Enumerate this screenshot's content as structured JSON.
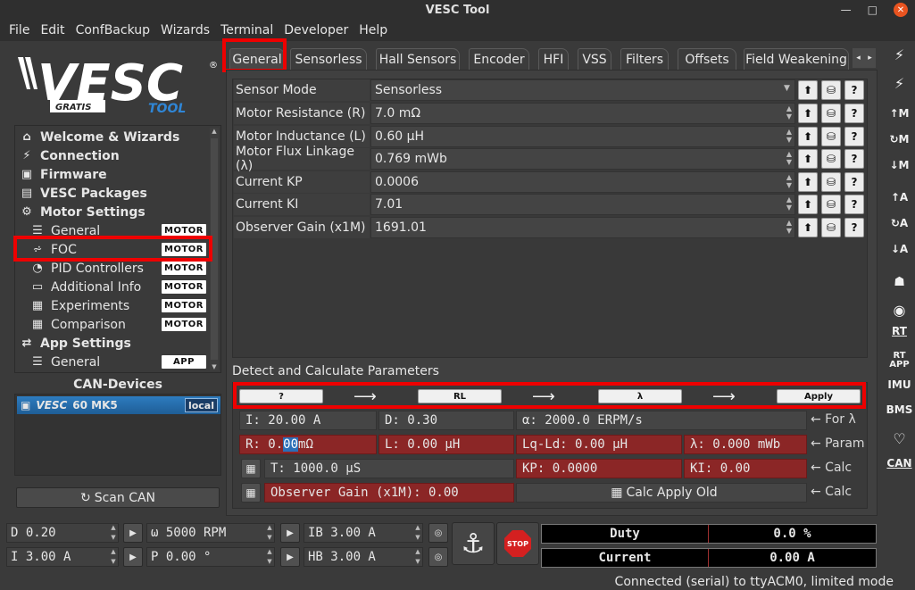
{
  "window": {
    "title": "VESC Tool"
  },
  "menu": [
    "File",
    "Edit",
    "ConfBackup",
    "Wizards",
    "Terminal",
    "Developer",
    "Help"
  ],
  "logo": {
    "brand": "VESC",
    "sub_left": "GRATIS",
    "sub_right": "TOOL",
    "reg": "®"
  },
  "nav": {
    "items": [
      {
        "label": "Welcome & Wizards",
        "icon": "home-icon"
      },
      {
        "label": "Connection",
        "icon": "plug-icon"
      },
      {
        "label": "Firmware",
        "icon": "chip-icon"
      },
      {
        "label": "VESC Packages",
        "icon": "package-icon"
      },
      {
        "label": "Motor Settings",
        "icon": "motor-icon"
      },
      {
        "label": "General",
        "icon": "sliders-icon",
        "badge": "MOTOR"
      },
      {
        "label": "FOC",
        "icon": "foc-icon",
        "badge": "MOTOR"
      },
      {
        "label": "PID Controllers",
        "icon": "gauge-icon",
        "badge": "MOTOR"
      },
      {
        "label": "Additional Info",
        "icon": "info-icon",
        "badge": "MOTOR"
      },
      {
        "label": "Experiments",
        "icon": "calculator-icon",
        "badge": "MOTOR"
      },
      {
        "label": "Comparison",
        "icon": "calculator-icon",
        "badge": "MOTOR"
      },
      {
        "label": "App Settings",
        "icon": "app-icon"
      },
      {
        "label": "General",
        "icon": "sliders-icon",
        "badge": "APP"
      }
    ]
  },
  "can": {
    "title": "CAN-Devices",
    "device": "60 MK5",
    "device_brand": "VESC",
    "local": "local",
    "scan_label": "Scan CAN"
  },
  "tabs": [
    "General",
    "Sensorless",
    "Hall Sensors",
    "Encoder",
    "HFI",
    "VSS",
    "Filters",
    "Offsets",
    "Field Weakening"
  ],
  "params": [
    {
      "label": "Sensor Mode",
      "value": "Sensorless"
    },
    {
      "label": "Motor Resistance (R)",
      "value": "7.0 mΩ"
    },
    {
      "label": "Motor Inductance (L)",
      "value": "0.60 µH"
    },
    {
      "label": "Motor Flux Linkage (λ)",
      "value": "0.769 mWb"
    },
    {
      "label": "Current KP",
      "value": "0.0006"
    },
    {
      "label": "Current KI",
      "value": "7.01"
    },
    {
      "label": "Observer Gain (x1M)",
      "value": "1691.01"
    }
  ],
  "detect": {
    "title": "Detect and Calculate Parameters",
    "btn_rl": "RL",
    "btn_lambda": "λ",
    "btn_apply": "Apply",
    "current": "I: 20.00 A",
    "duty": "D: 0.30",
    "erpm": "α: 2000.0 ERPM/s",
    "for_lambda": "← For λ",
    "r": "R: 0.00 mΩ",
    "r_prefix": "R: 0.",
    "r_sel": "00",
    "r_suffix": " mΩ",
    "l": "L: 0.00 µH",
    "lqld": "Lq-Ld: 0.00 µH",
    "lambda": "λ: 0.000 mWb",
    "param": "← Param",
    "t": "T: 1000.0 µS",
    "kp": "KP: 0.0000",
    "ki": "KI: 0.00",
    "calc1": "← Calc",
    "obs": "Observer Gain (x1M): 0.00",
    "calc_apply_old": "Calc Apply Old",
    "calc2": "← Calc"
  },
  "bottom": {
    "d": "D 0.20",
    "i": "I 3.00 A",
    "w": "ω 5000 RPM",
    "p": "P 0.00 °",
    "ib": "IB 3.00 A",
    "hb": "HB 3.00 A",
    "stop": "STOP",
    "duty_label": "Duty",
    "duty_value": "0.0 %",
    "current_label": "Current",
    "current_value": "0.00 A"
  },
  "right_toolbar": [
    "↑M",
    "↻M",
    "↓M",
    "↑A",
    "↻A",
    "↓A",
    "RT",
    "RT APP",
    "IMU",
    "BMS",
    "CAN"
  ],
  "status": "Connected (serial) to ttyACM0, limited mode"
}
